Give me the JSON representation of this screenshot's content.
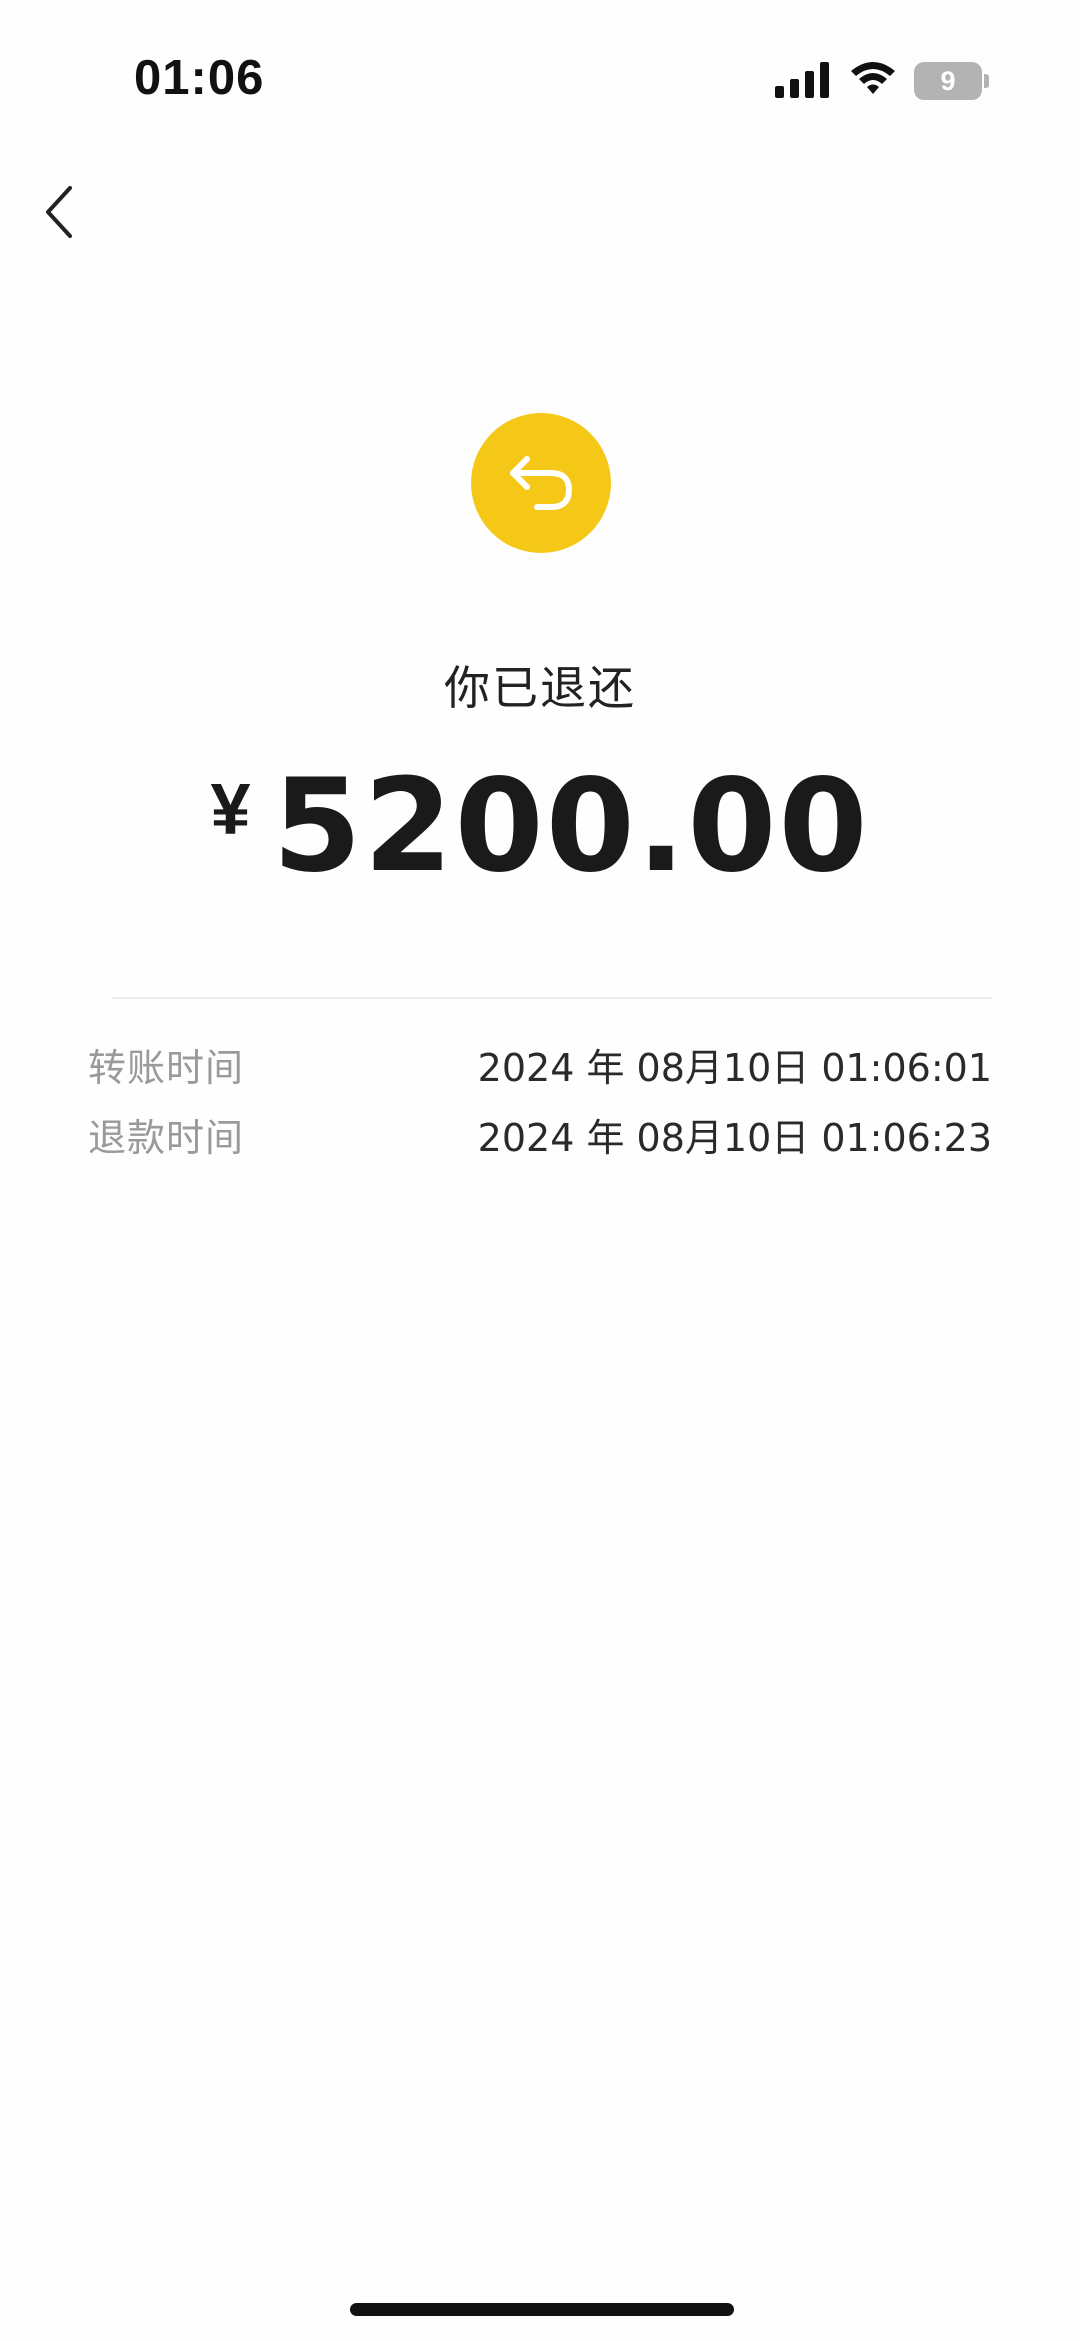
{
  "status_bar": {
    "time": "01:06",
    "battery_level": "9"
  },
  "main": {
    "status_title": "你已退还",
    "currency_symbol": "¥",
    "amount": "5200.00"
  },
  "details": [
    {
      "label": "转账时间",
      "value": "2024 年 08月10日 01:06:01"
    },
    {
      "label": "退款时间",
      "value": "2024 年 08月10日 01:06:23"
    }
  ],
  "colors": {
    "accent": "#f5c817",
    "label_gray": "#9a9a9a",
    "text_dark": "#1a1a1a",
    "background": "#fefefe"
  },
  "icons": {
    "back": "chevron-left-icon",
    "refund": "return-arrow-icon",
    "signal": "cellular-signal-icon",
    "wifi": "wifi-icon",
    "battery": "battery-icon"
  }
}
